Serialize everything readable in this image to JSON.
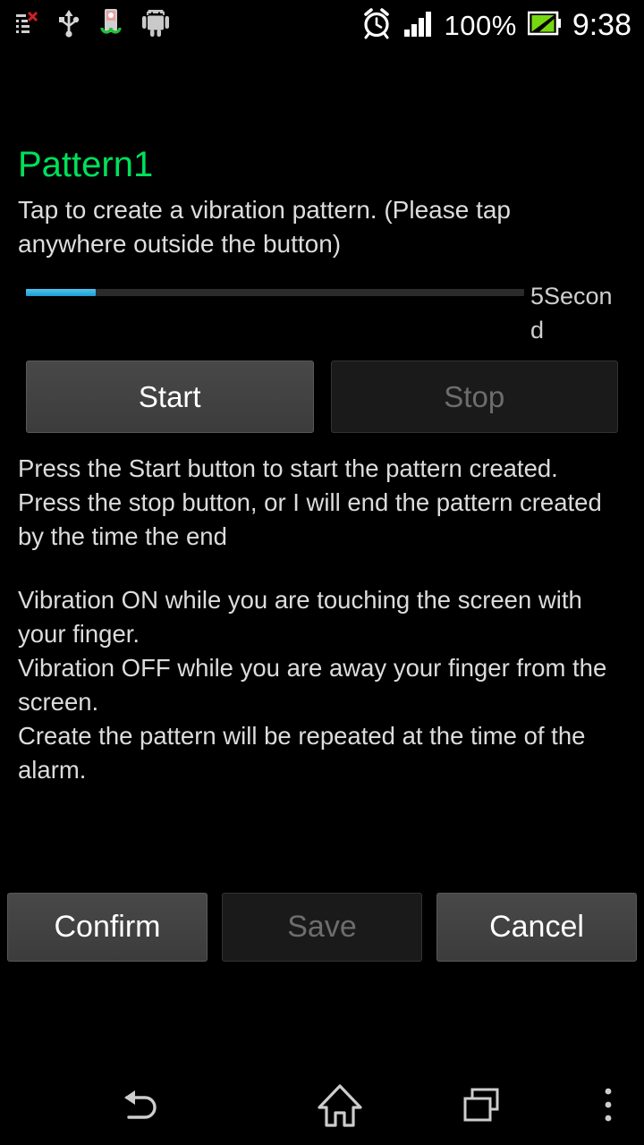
{
  "statusbar": {
    "left_icons": [
      {
        "name": "tasks-dismiss-icon",
        "glyph": "list-x"
      },
      {
        "name": "usb-icon",
        "glyph": "usb"
      },
      {
        "name": "sync-battery-icon",
        "glyph": "sync"
      },
      {
        "name": "android-robot-icon",
        "glyph": "android"
      }
    ],
    "alarm_icon": "alarm-clock-icon",
    "signal_icon": "signal-bars-icon",
    "battery_percent": "100%",
    "battery_icon": "battery-charging-icon",
    "time": "9:38"
  },
  "screen": {
    "title": "Pattern1",
    "title_color": "#00e05a",
    "subtitle": "Tap to create a vibration pattern. (Please tap anywhere outside the button)"
  },
  "seekbar": {
    "value_percent": 14,
    "label": "5Second",
    "fill_color": "#2ea9dd",
    "track_color": "#2b2b2b"
  },
  "controls": {
    "start_label": "Start",
    "start_enabled": true,
    "stop_label": "Stop",
    "stop_enabled": false
  },
  "info": {
    "paragraph1_line1": "Press the Start button to start the pattern created.",
    "paragraph1_line2": "Press the stop button, or I will end the pattern created by the time the end",
    "paragraph2_line1": "Vibration ON while you are touching the screen with your finger.",
    "paragraph2_line2": "Vibration OFF while you are away your finger from the screen.",
    "paragraph2_line3": "Create the pattern will be repeated at the time of the alarm."
  },
  "actions": {
    "confirm_label": "Confirm",
    "confirm_enabled": true,
    "save_label": "Save",
    "save_enabled": false,
    "cancel_label": "Cancel",
    "cancel_enabled": true
  },
  "navbar": {
    "back": "back-icon",
    "home": "home-icon",
    "recents": "recents-icon",
    "menu": "overflow-menu-icon"
  }
}
